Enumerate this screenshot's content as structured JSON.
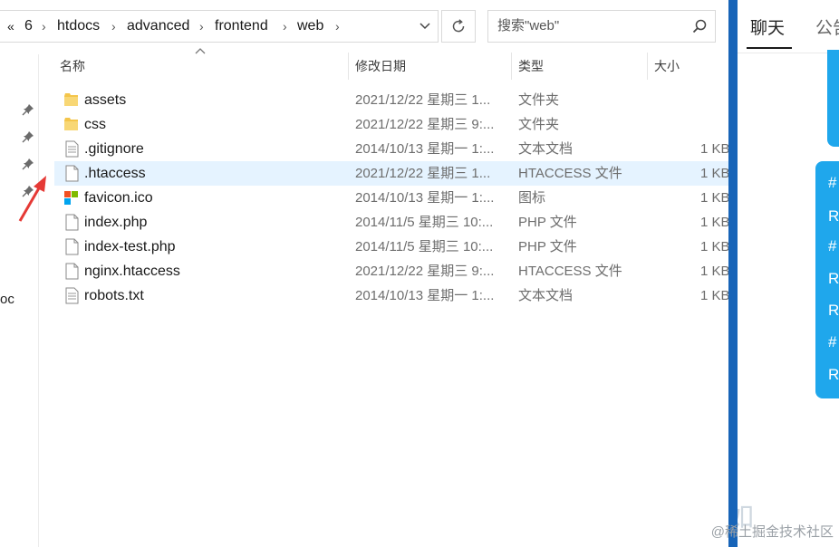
{
  "breadcrumb": {
    "overflow": "«",
    "items": [
      "6",
      "htdocs",
      "advanced",
      "frontend",
      "web"
    ]
  },
  "search": {
    "placeholder": "搜索\"web\""
  },
  "nav": {
    "partial_label": "oc"
  },
  "columns": {
    "name": "名称",
    "date": "修改日期",
    "type": "类型",
    "size": "大小"
  },
  "files": [
    {
      "name": "assets",
      "date": "2021/12/22 星期三 1...",
      "type": "文件夹",
      "size": "",
      "icon": "folder-icon"
    },
    {
      "name": "css",
      "date": "2021/12/22 星期三 9:...",
      "type": "文件夹",
      "size": "",
      "icon": "folder-icon"
    },
    {
      "name": ".gitignore",
      "date": "2014/10/13 星期一 1:...",
      "type": "文本文档",
      "size": "1 KB",
      "icon": "text-file-icon"
    },
    {
      "name": ".htaccess",
      "date": "2021/12/22 星期三 1...",
      "type": "HTACCESS 文件",
      "size": "1 KB",
      "icon": "file-icon"
    },
    {
      "name": "favicon.ico",
      "date": "2014/10/13 星期一 1:...",
      "type": "图标",
      "size": "1 KB",
      "icon": "image-icon"
    },
    {
      "name": "index.php",
      "date": "2014/11/5 星期三 10:...",
      "type": "PHP 文件",
      "size": "1 KB",
      "icon": "file-icon"
    },
    {
      "name": "index-test.php",
      "date": "2014/11/5 星期三 10:...",
      "type": "PHP 文件",
      "size": "1 KB",
      "icon": "file-icon"
    },
    {
      "name": "nginx.htaccess",
      "date": "2021/12/22 星期三 9:...",
      "type": "HTACCESS 文件",
      "size": "1 KB",
      "icon": "file-icon"
    },
    {
      "name": "robots.txt",
      "date": "2014/10/13 星期一 1:...",
      "type": "文本文档",
      "size": "1 KB",
      "icon": "text-file-icon"
    }
  ],
  "selected_file": ".htaccess",
  "chat": {
    "tabs": [
      "聊天",
      "公告"
    ],
    "bubble_lines": [
      "#",
      "R",
      "#",
      "R",
      "R",
      "#",
      "R"
    ],
    "faint_text": "如"
  },
  "watermark": "@稀土掘金技术社区",
  "colors": {
    "selection": "#e5f3ff",
    "accent": "#1fa7ec",
    "divider": "#1764b8",
    "folder": "#f4c54a",
    "arrow": "#e53935"
  }
}
